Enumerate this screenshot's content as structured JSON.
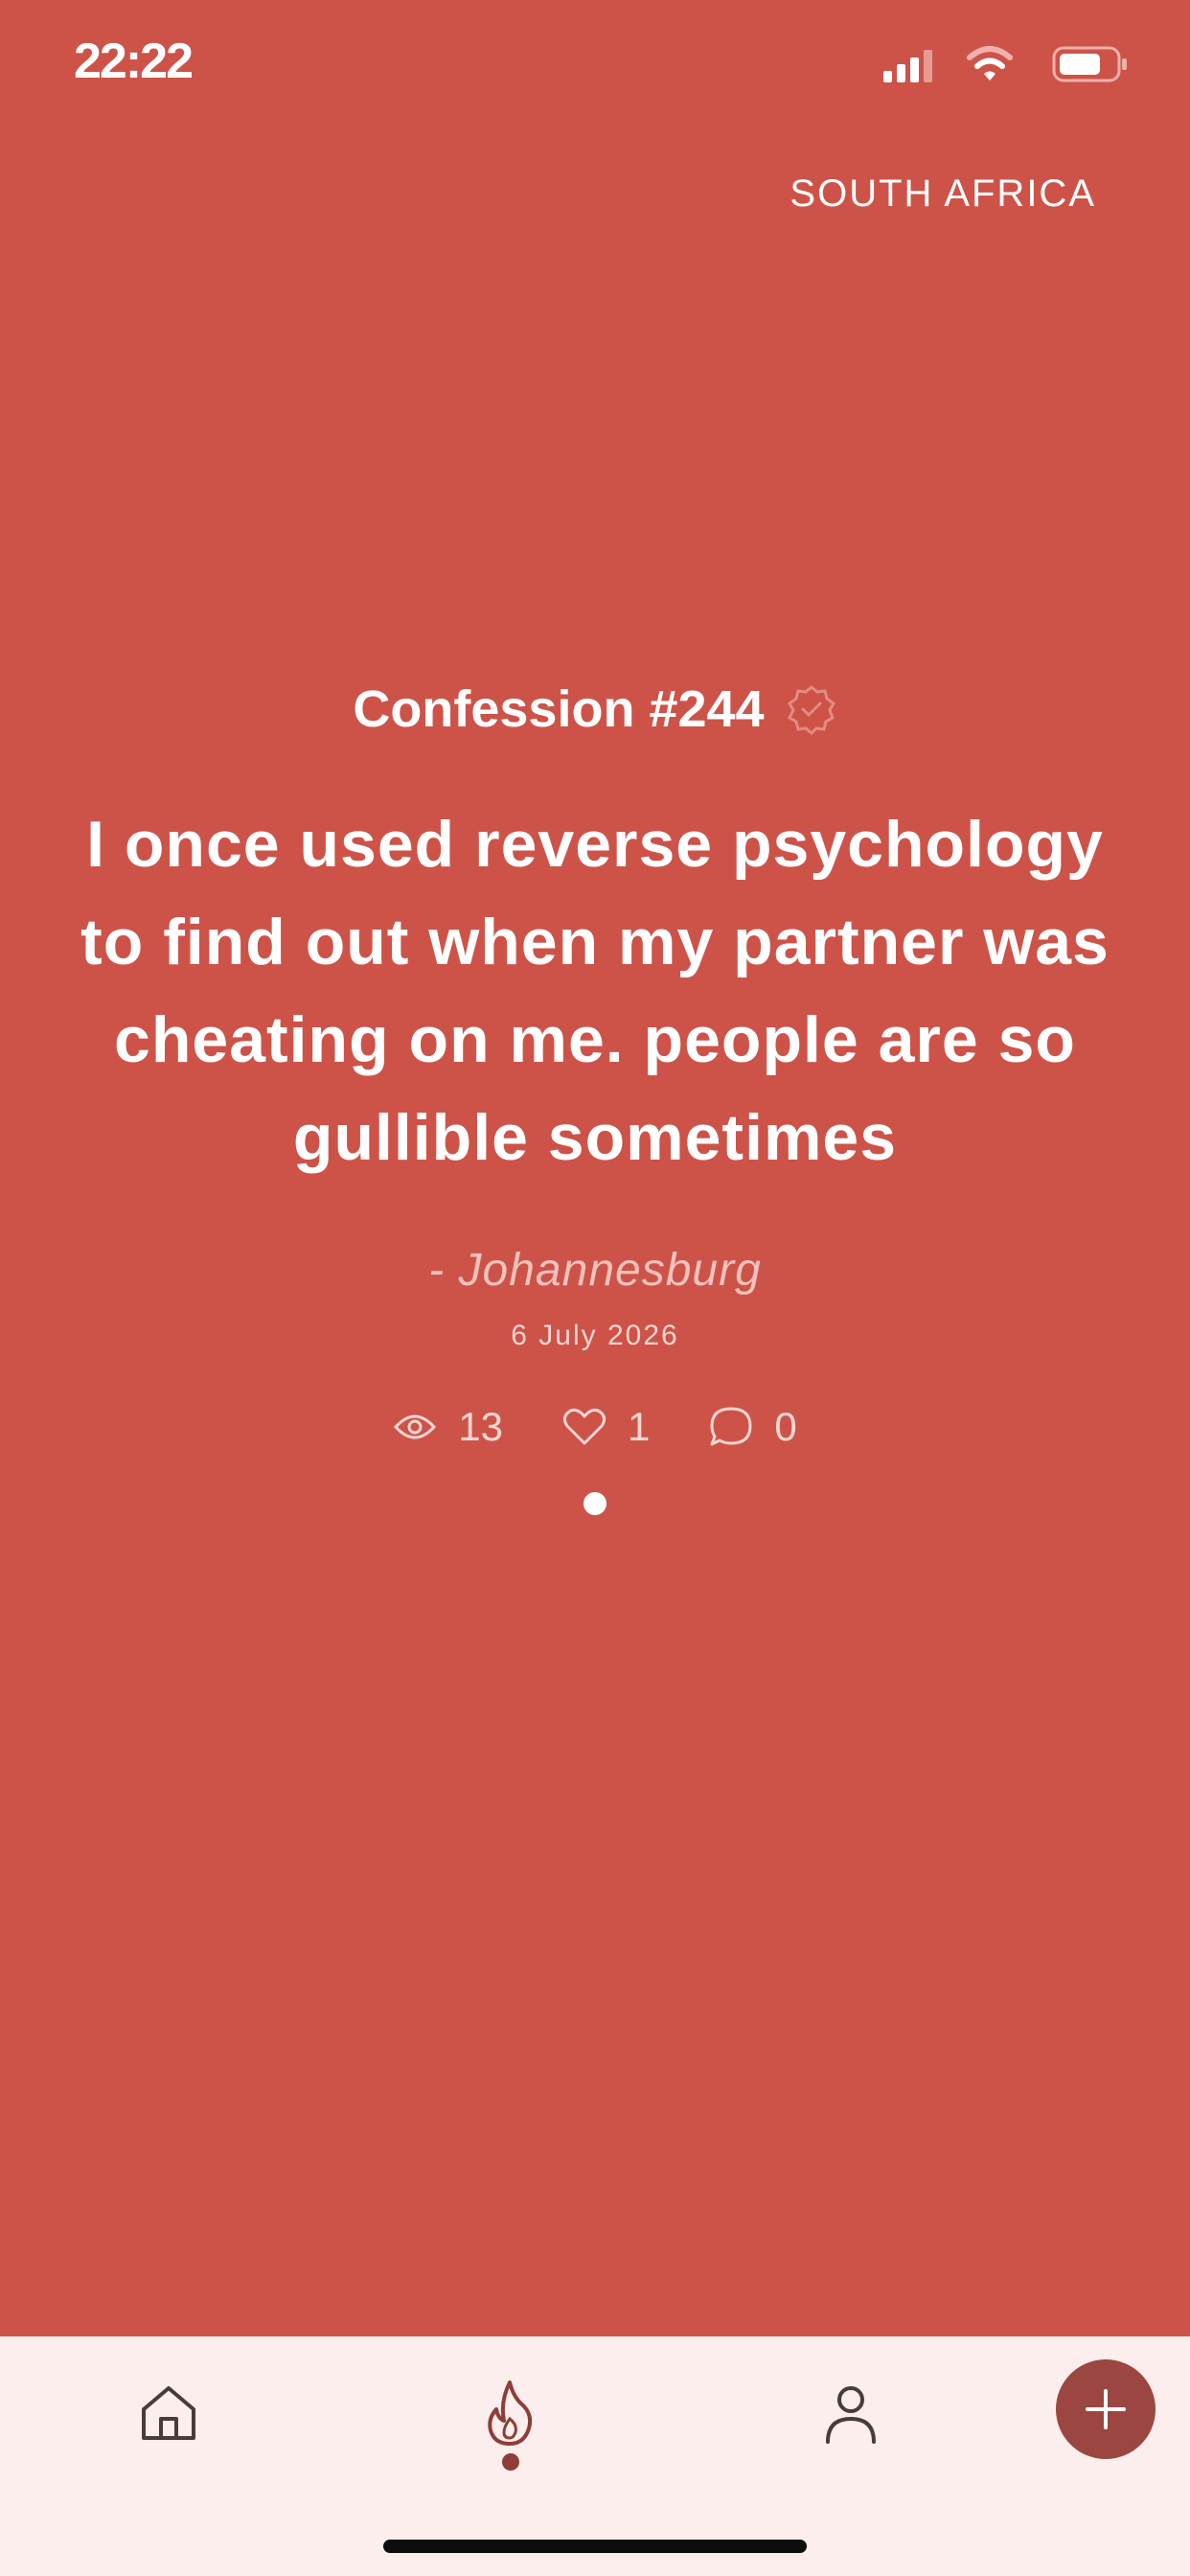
{
  "status_bar": {
    "time": "22:22"
  },
  "region": {
    "label": "SOUTH AFRICA"
  },
  "confession": {
    "title": "Confession #244",
    "text": "I once used reverse psychology to find out when my partner was cheating on me. people are so gullible sometimes",
    "author": "- Johannesburg",
    "date": "6 July 2026",
    "stats": {
      "views": "13",
      "likes": "1",
      "comments": "0"
    }
  },
  "colors": {
    "background": "#cd5349",
    "tab_bar": "#fbeeec",
    "fab": "#9c4642",
    "active_tab": "#8e3d38"
  },
  "icons": {
    "status": [
      "signal-icon",
      "wifi-icon",
      "battery-icon"
    ],
    "title": "verified-badge-icon",
    "stats": [
      "eye-icon",
      "heart-icon",
      "comment-icon"
    ],
    "tabs": [
      "home-icon",
      "flame-icon",
      "person-icon",
      "plus-icon"
    ]
  },
  "tabs": {
    "active": "flame"
  }
}
